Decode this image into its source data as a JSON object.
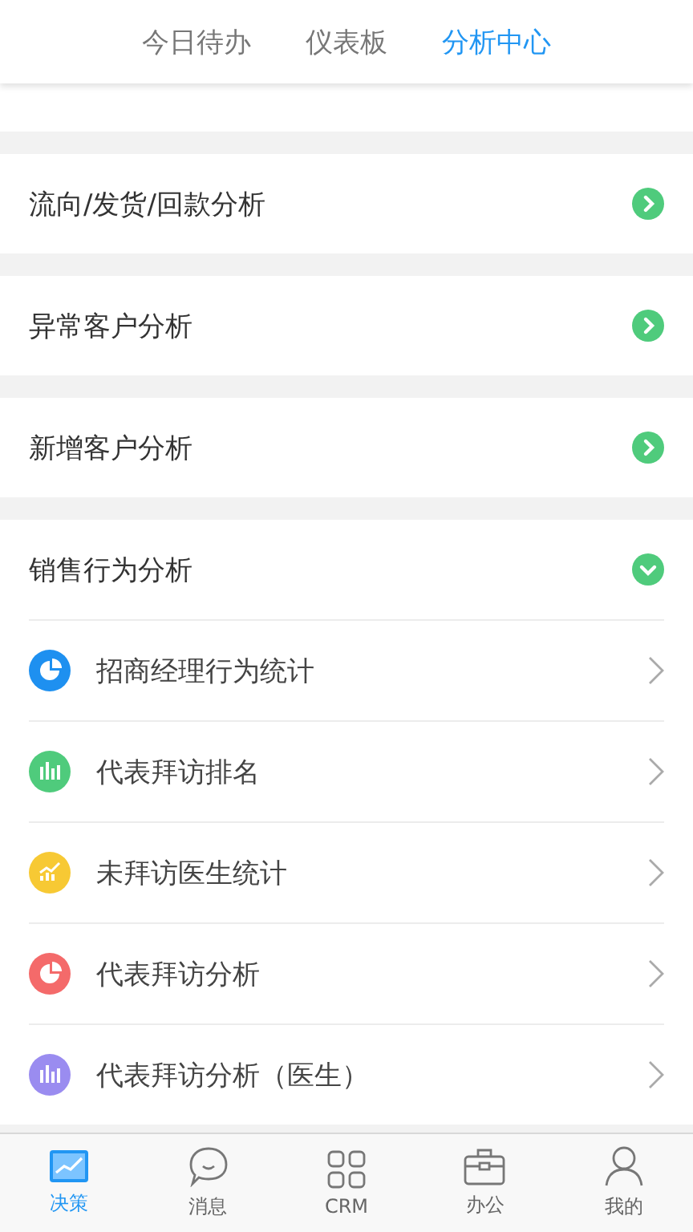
{
  "tabs": [
    {
      "label": "今日待办",
      "selected": false
    },
    {
      "label": "仪表板",
      "selected": false
    },
    {
      "label": "分析中心",
      "selected": true
    }
  ],
  "sections": [
    {
      "title": "流向/发货/回款分析",
      "expanded": false
    },
    {
      "title": "异常客户分析",
      "expanded": false
    },
    {
      "title": "新增客户分析",
      "expanded": false
    },
    {
      "title": "销售行为分析",
      "expanded": true,
      "items": [
        {
          "label": "招商经理行为统计",
          "kind": "pie",
          "color": "#1e90f0"
        },
        {
          "label": "代表拜访排名",
          "kind": "bar",
          "color": "#4fcb7c"
        },
        {
          "label": "未拜访医生统计",
          "kind": "trend",
          "color": "#f7c934"
        },
        {
          "label": "代表拜访分析",
          "kind": "pie",
          "color": "#f46a6a"
        },
        {
          "label": "代表拜访分析（医生）",
          "kind": "bar",
          "color": "#9a8cf0"
        }
      ]
    }
  ],
  "nav": [
    {
      "label": "决策",
      "kind": "chart",
      "selected": true
    },
    {
      "label": "消息",
      "kind": "chat",
      "selected": false
    },
    {
      "label": "CRM",
      "kind": "grid",
      "selected": false
    },
    {
      "label": "办公",
      "kind": "briefcase",
      "selected": false
    },
    {
      "label": "我的",
      "kind": "person",
      "selected": false
    }
  ]
}
